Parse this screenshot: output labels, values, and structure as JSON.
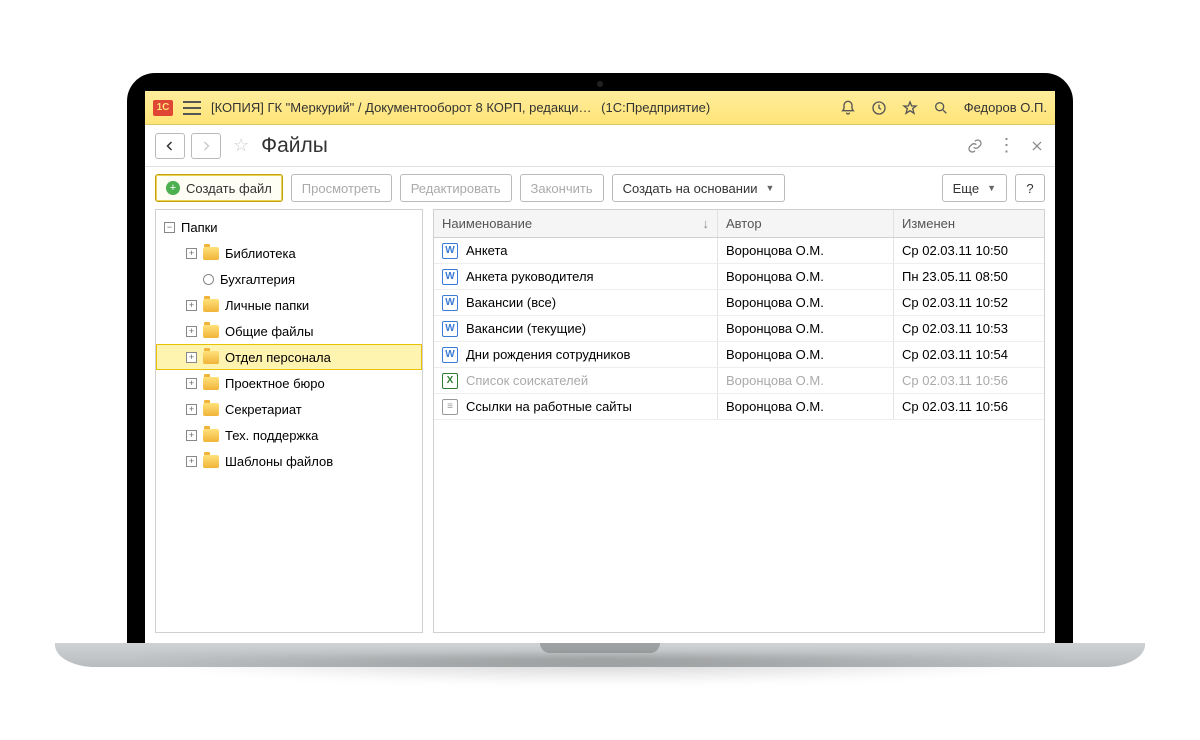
{
  "titlebar": {
    "app_title": "[КОПИЯ] ГК \"Меркурий\" / Документооборот 8 КОРП, редакци…",
    "edition": "(1С:Предприятие)",
    "user": "Федоров О.П."
  },
  "page": {
    "title": "Файлы"
  },
  "toolbar": {
    "create": "Создать файл",
    "view": "Просмотреть",
    "edit": "Редактировать",
    "finish": "Закончить",
    "create_based": "Создать на основании",
    "more": "Еще",
    "help": "?"
  },
  "tree": {
    "root": "Папки",
    "items": [
      {
        "label": "Библиотека",
        "expander": "plus",
        "icon": "folder"
      },
      {
        "label": "Бухгалтерия",
        "expander": "none",
        "icon": "circle"
      },
      {
        "label": "Личные папки",
        "expander": "plus",
        "icon": "folder"
      },
      {
        "label": "Общие файлы",
        "expander": "plus",
        "icon": "folder"
      },
      {
        "label": "Отдел персонала",
        "expander": "plus",
        "icon": "folder",
        "selected": true
      },
      {
        "label": "Проектное бюро",
        "expander": "plus",
        "icon": "folder"
      },
      {
        "label": "Секретариат",
        "expander": "plus",
        "icon": "folder"
      },
      {
        "label": "Тех. поддержка",
        "expander": "plus",
        "icon": "folder"
      },
      {
        "label": "Шаблоны файлов",
        "expander": "plus",
        "icon": "folder"
      }
    ]
  },
  "columns": {
    "name": "Наименование",
    "author": "Автор",
    "modified": "Изменен"
  },
  "files": [
    {
      "name": "Анкета",
      "author": "Воронцова О.М.",
      "date": "Ср 02.03.11 10:50",
      "type": "word"
    },
    {
      "name": "Анкета руководителя",
      "author": "Воронцова О.М.",
      "date": "Пн 23.05.11 08:50",
      "type": "word"
    },
    {
      "name": "Вакансии (все)",
      "author": "Воронцова О.М.",
      "date": "Ср 02.03.11 10:52",
      "type": "word"
    },
    {
      "name": "Вакансии (текущие)",
      "author": "Воронцова О.М.",
      "date": "Ср 02.03.11 10:53",
      "type": "word"
    },
    {
      "name": "Дни рождения сотрудников",
      "author": "Воронцова О.М.",
      "date": "Ср 02.03.11 10:54",
      "type": "word"
    },
    {
      "name": "Список соискателей",
      "author": "Воронцова О.М.",
      "date": "Ср 02.03.11 10:56",
      "type": "excel",
      "dimmed": true
    },
    {
      "name": "Ссылки на работные сайты",
      "author": "Воронцова О.М.",
      "date": "Ср 02.03.11 10:56",
      "type": "txt"
    }
  ]
}
